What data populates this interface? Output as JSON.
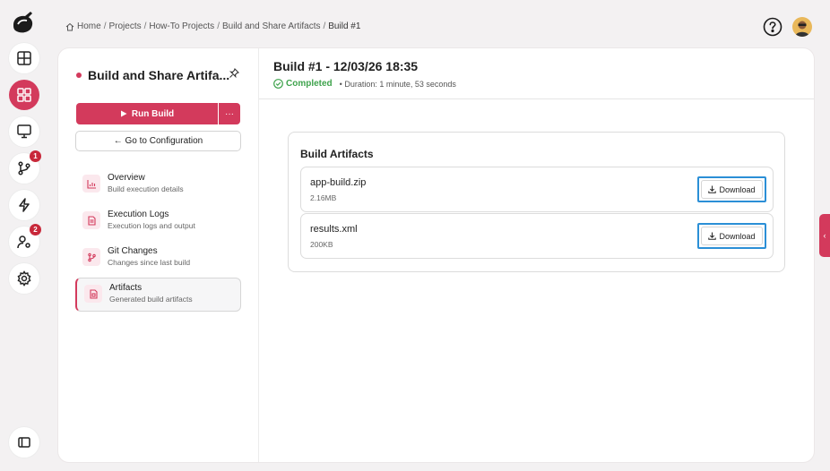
{
  "breadcrumb": {
    "items": [
      "Home",
      "Projects",
      "How-To Projects",
      "Build and Share Artifacts",
      "Build #1"
    ],
    "separator": "/"
  },
  "rail": {
    "items": [
      {
        "icon": "dashboard-icon"
      },
      {
        "icon": "projects-icon"
      },
      {
        "icon": "monitor-icon"
      },
      {
        "icon": "git-branch-icon",
        "badge": "1"
      },
      {
        "icon": "lightning-icon"
      },
      {
        "icon": "users-settings-icon",
        "badge": "2"
      },
      {
        "icon": "gear-icon"
      },
      {
        "icon": "sidebar-toggle-icon"
      }
    ]
  },
  "project": {
    "title": "Build and Share Artifa...",
    "run_label": "Run Build",
    "more_label": "···",
    "config_label": "← Go to Configuration"
  },
  "nav": [
    {
      "title": "Overview",
      "subtitle": "Build execution details"
    },
    {
      "title": "Execution Logs",
      "subtitle": "Execution logs and output"
    },
    {
      "title": "Git Changes",
      "subtitle": "Changes since last build"
    },
    {
      "title": "Artifacts",
      "subtitle": "Generated build artifacts"
    }
  ],
  "build": {
    "title": "Build #1 - 12/03/26 18:35",
    "status": "Completed",
    "duration": "• Duration: 1 minute, 53 seconds"
  },
  "artifacts": {
    "heading": "Build Artifacts",
    "download_label": "Download",
    "items": [
      {
        "name": "app-build.zip",
        "size": "2.16MB"
      },
      {
        "name": "results.xml",
        "size": "200KB"
      }
    ]
  },
  "side_tab": {
    "label": "‹"
  },
  "colors": {
    "accent": "#d33a5c",
    "success": "#3fa34d",
    "focus": "#2b8fd6"
  }
}
